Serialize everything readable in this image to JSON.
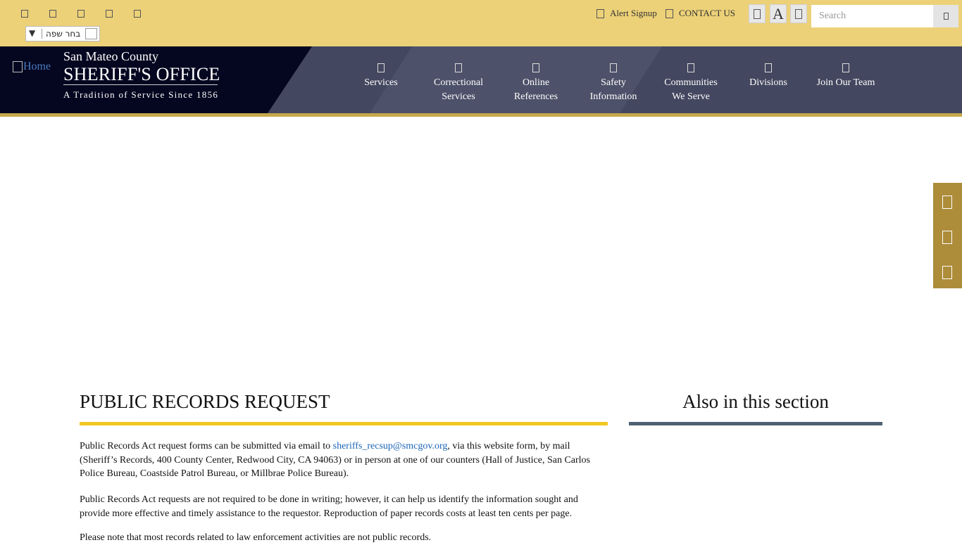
{
  "topbar": {
    "language": {
      "label": "בחר שפה",
      "arrow": "▼"
    },
    "alert_signup": "Alert Signup",
    "contact_us": "CONTACT US",
    "font_size_large": "A",
    "search": {
      "placeholder": "Search"
    }
  },
  "header": {
    "logo_alt": "Home",
    "county": "San Mateo County",
    "office": "SHERIFF'S OFFICE",
    "tagline": "A Tradition of Service Since 1856"
  },
  "nav": [
    {
      "line1": "Services",
      "line2": ""
    },
    {
      "line1": "Correctional",
      "line2": "Services"
    },
    {
      "line1": "Online",
      "line2": "References"
    },
    {
      "line1": "Safety",
      "line2": "Information"
    },
    {
      "line1": "Communities",
      "line2": "We Serve"
    },
    {
      "line1": "Divisions",
      "line2": ""
    },
    {
      "line1": "Join Our Team",
      "line2": ""
    }
  ],
  "content": {
    "title": "PUBLIC RECORDS REQUEST",
    "p1": {
      "before": "Public Records Act request forms can be submitted via email to ",
      "link": "sheriffs_recsup@smcgov.org",
      "after": ", via this website form, by mail (Sheriff’s Records, 400 County Center, Redwood City, CA 94063) or in person at one of our counters (Hall of Justice, San Carlos Police Bureau, Coastside Patrol Bureau, or Millbrae Police Bureau)."
    },
    "p2": "Public Records Act requests are not required to be done in writing; however, it can help us identify the information sought and provide more effective and timely assistance to the requestor. Reproduction of paper records costs at least ten cents per page.",
    "p3": "Please note that most records related to law enforcement activities are not public records."
  },
  "sidebar": {
    "title": "Also in this section"
  },
  "colors": {
    "topbar": "#ecd178",
    "header": "#43475f",
    "header_dark": "#050620",
    "gold_strip": "#c6a84c",
    "title_underline": "#f1c721",
    "side_underline": "#4e6172",
    "side_tab": "#ad8c3a",
    "link": "#1c64b8"
  }
}
